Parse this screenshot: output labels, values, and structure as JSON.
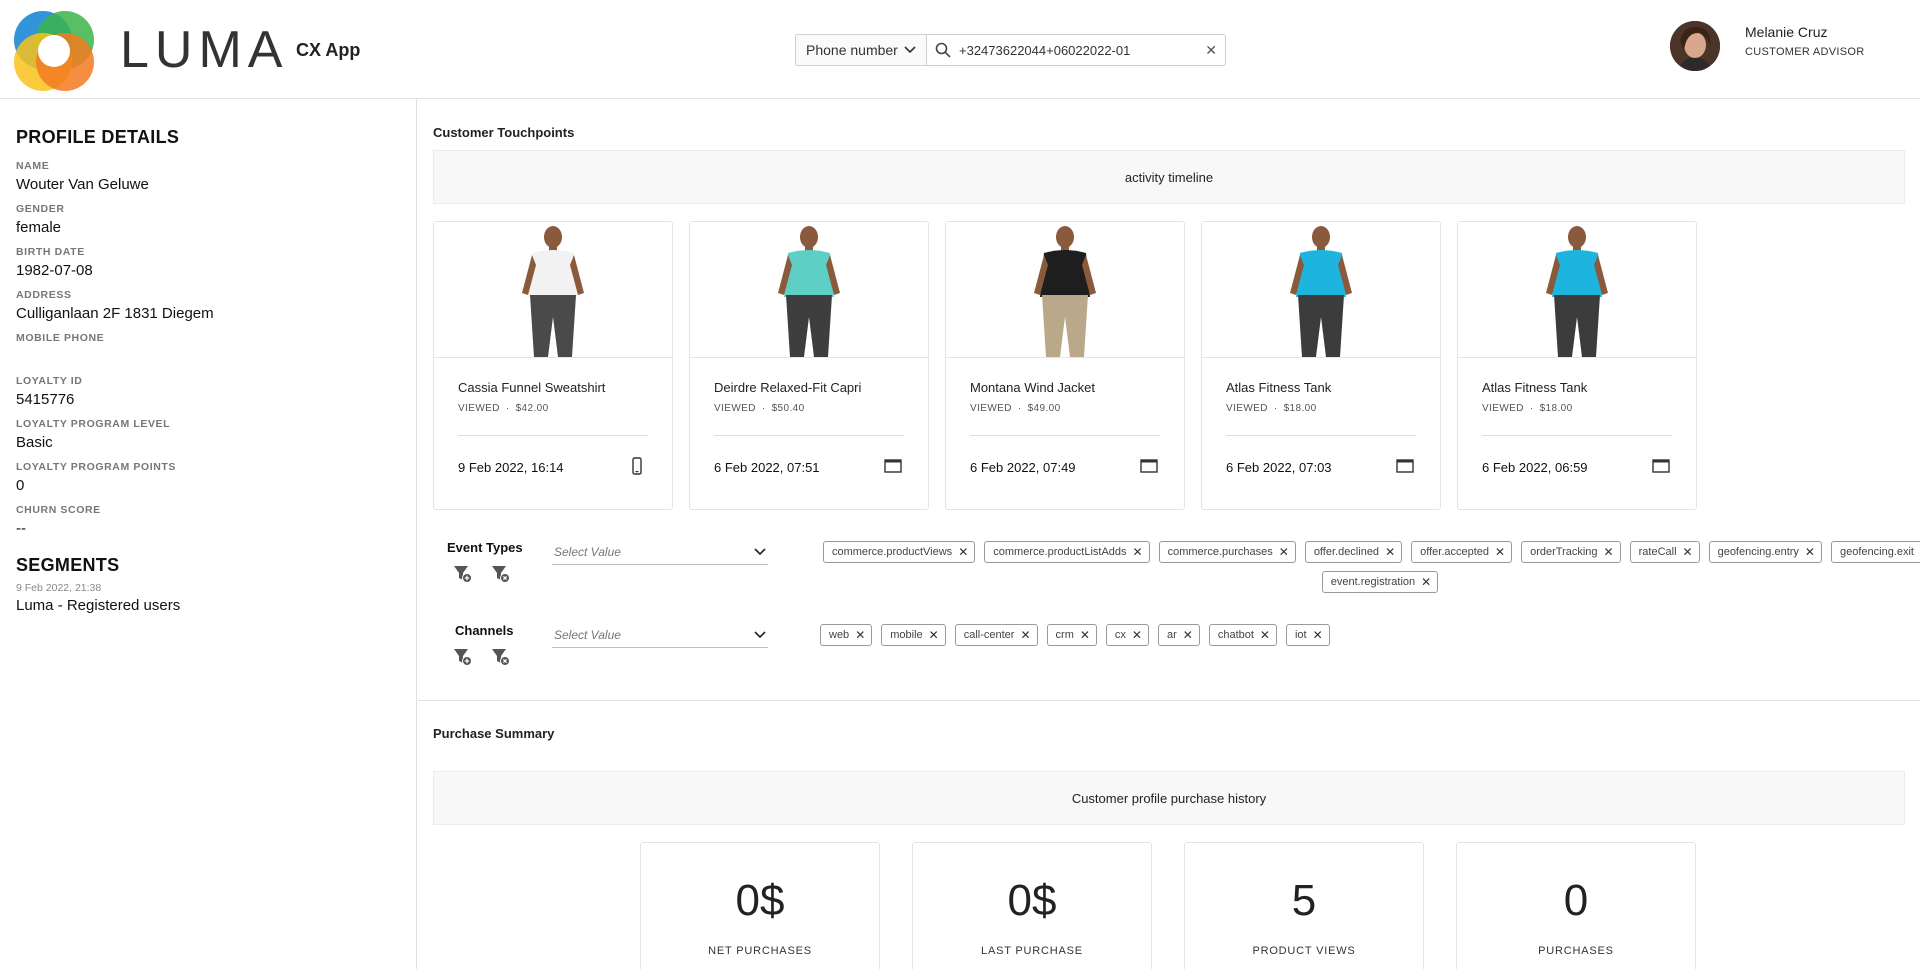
{
  "brand": {
    "logo_text": "LUMA",
    "app_name": "CX App"
  },
  "search": {
    "type_label": "Phone number",
    "value": "+32473622044+06022022-01"
  },
  "user": {
    "name": "Melanie Cruz",
    "role": "CUSTOMER ADVISOR"
  },
  "profile": {
    "title": "PROFILE DETAILS",
    "fields": [
      {
        "label": "NAME",
        "value": "Wouter Van Geluwe"
      },
      {
        "label": "GENDER",
        "value": "female"
      },
      {
        "label": "BIRTH DATE",
        "value": "1982-07-08"
      },
      {
        "label": "ADDRESS",
        "value": "Culliganlaan 2F 1831 Diegem"
      },
      {
        "label": "MOBILE PHONE",
        "value": ""
      },
      {
        "label": "LOYALTY ID",
        "value": "5415776"
      },
      {
        "label": "LOYALTY PROGRAM LEVEL",
        "value": "Basic"
      },
      {
        "label": "LOYALTY PROGRAM POINTS",
        "value": "0"
      },
      {
        "label": "CHURN SCORE",
        "value": "--"
      }
    ]
  },
  "segments": {
    "title": "SEGMENTS",
    "items": [
      {
        "date": "9 Feb 2022, 21:38",
        "name": "Luma - Registered users"
      }
    ]
  },
  "touchpoints": {
    "title": "Customer Touchpoints",
    "banner": "activity timeline",
    "cards": [
      {
        "name": "Cassia Funnel Sweatshirt",
        "action": "VIEWED",
        "price": "$42.00",
        "date": "9 Feb 2022, 16:14",
        "device": "mobile-icon",
        "shirt": "#f2f2f2",
        "pants": "#4a4a4a"
      },
      {
        "name": "Deirdre Relaxed-Fit Capri",
        "action": "VIEWED",
        "price": "$50.40",
        "date": "6 Feb 2022, 07:51",
        "device": "desktop-icon",
        "shirt": "#5ecfc4",
        "pants": "#3e3e3e"
      },
      {
        "name": "Montana Wind Jacket",
        "action": "VIEWED",
        "price": "$49.00",
        "date": "6 Feb 2022, 07:49",
        "device": "desktop-icon",
        "shirt": "#1e1e1e",
        "pants": "#b9a98a"
      },
      {
        "name": "Atlas Fitness Tank",
        "action": "VIEWED",
        "price": "$18.00",
        "date": "6 Feb 2022, 07:03",
        "device": "desktop-icon",
        "shirt": "#1eb4e0",
        "pants": "#3c3c3c"
      },
      {
        "name": "Atlas Fitness Tank",
        "action": "VIEWED",
        "price": "$18.00",
        "date": "6 Feb 2022, 06:59",
        "device": "desktop-icon",
        "shirt": "#1eb4e0",
        "pants": "#3c3c3c"
      }
    ]
  },
  "filters": {
    "event_types": {
      "label": "Event Types",
      "placeholder": "Select Value",
      "tags": [
        "commerce.productViews",
        "commerce.productListAdds",
        "commerce.purchases",
        "offer.declined",
        "offer.accepted",
        "orderTracking",
        "rateCall",
        "geofencing.entry",
        "geofencing.exit",
        "event.registration"
      ]
    },
    "channels": {
      "label": "Channels",
      "placeholder": "Select Value",
      "tags": [
        "web",
        "mobile",
        "call-center",
        "crm",
        "cx",
        "ar",
        "chatbot",
        "iot"
      ]
    }
  },
  "purchase": {
    "title": "Purchase Summary",
    "banner": "Customer profile purchase history",
    "stats": [
      {
        "value": "0$",
        "label": "NET PURCHASES"
      },
      {
        "value": "0$",
        "label": "LAST PURCHASE"
      },
      {
        "value": "5",
        "label": "PRODUCT VIEWS"
      },
      {
        "value": "0",
        "label": "PURCHASES"
      }
    ]
  },
  "colors": {
    "logo_blue": "#1c8ad6",
    "logo_green": "#3bb44a",
    "logo_yellow": "#f8c21b",
    "logo_orange": "#f47a20",
    "tag_border": "#9a9a9a"
  }
}
